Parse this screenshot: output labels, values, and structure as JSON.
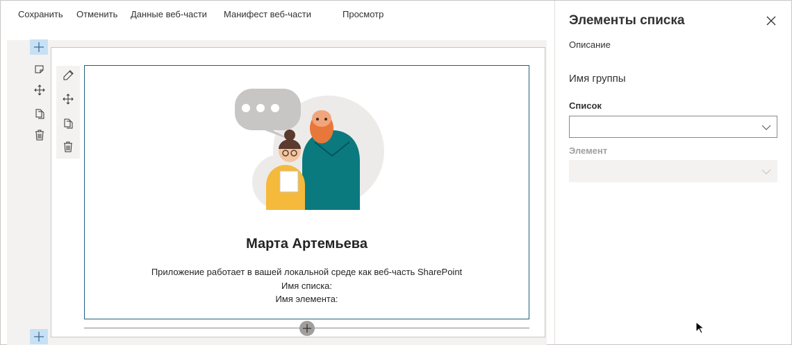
{
  "toolbar": {
    "save_label": "Сохранить",
    "cancel_label": "Отменить",
    "webpart_data_label": "Данные веб-части",
    "manifest_label": "Манифест веб-части",
    "preview_label": "Просмотр"
  },
  "webpart": {
    "user_name": "Марта Артемьева",
    "environment_text": "Приложение работает в вашей локальной среде как веб-часть SharePoint",
    "list_name_label": "Имя списка:",
    "item_name_label": "Имя элемента:"
  },
  "pane": {
    "title": "Элементы списка",
    "description": "Описание",
    "group_name": "Имя группы",
    "list_label": "Список",
    "list_value": "",
    "item_label": "Элемент",
    "item_value": ""
  },
  "colors": {
    "accent_selected": "#c7e0f4",
    "webpart_border": "#1f5e7a",
    "disabled_field": "#f3f2f1",
    "disabled_label": "#a19f9d",
    "illustration_teal": "#0a7a7f",
    "illustration_yellow": "#f5b93c",
    "illustration_orange": "#e8773a"
  },
  "icons": {
    "add": "plus-icon",
    "edit": "pencil-icon",
    "move": "move-arrows-icon",
    "duplicate": "copy-icon",
    "delete": "trash-icon",
    "close": "close-icon",
    "dropdown": "chevron-down-icon"
  }
}
